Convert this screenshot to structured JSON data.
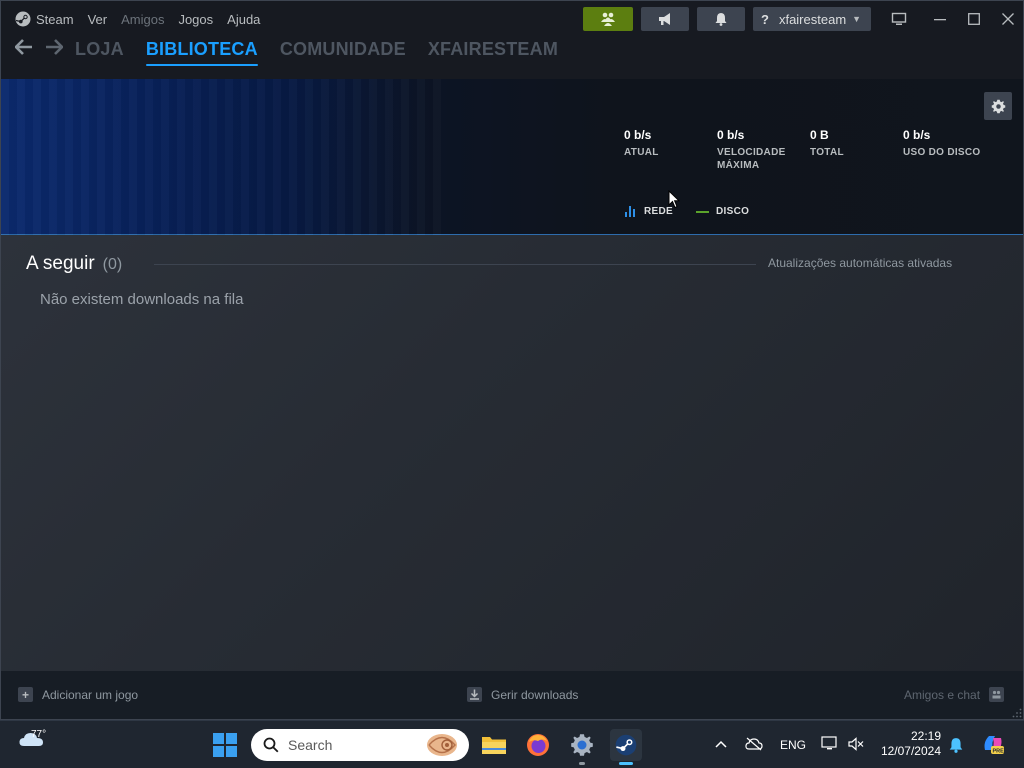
{
  "colors": {
    "accent": "#1a9fff",
    "friends_button": "#5c7e10",
    "rede_legend": "#2d8fe6",
    "disco_legend": "#5ba32b",
    "window_bg": "#171a21"
  },
  "menu": {
    "steam": "Steam",
    "ver": "Ver",
    "amigos": "Amigos",
    "jogos": "Jogos",
    "ajuda": "Ajuda"
  },
  "titlebar": {
    "account_help": "?",
    "account_name": "xfairesteam",
    "icons": [
      "friends-icon",
      "megaphone-icon",
      "bell-icon",
      "big-picture-icon",
      "minimize-icon",
      "maximize-icon",
      "close-icon"
    ]
  },
  "nav": {
    "tabs": [
      {
        "label": "LOJA",
        "active": false
      },
      {
        "label": "BIBLIOTECA",
        "active": true
      },
      {
        "label": "COMUNIDADE",
        "active": false
      },
      {
        "label": "XFAIRESTEAM",
        "active": false
      }
    ]
  },
  "stats": {
    "atual": {
      "value": "0 b/s",
      "label": "ATUAL"
    },
    "velocidade": {
      "value": "0 b/s",
      "label": "VELOCIDADE MÁXIMA"
    },
    "total": {
      "value": "0 B",
      "label": "TOTAL"
    },
    "disco": {
      "value": "0 b/s",
      "label": "USO DO DISCO"
    },
    "legend_rede": "REDE",
    "legend_disco": "DISCO"
  },
  "queue": {
    "title": "A seguir",
    "count": "(0)",
    "auto_updates": "Atualizações automáticas ativadas",
    "empty_message": "Não existem downloads na fila"
  },
  "footer": {
    "add_game": "Adicionar um jogo",
    "manage_downloads": "Gerir downloads",
    "friends_chat": "Amigos e chat"
  },
  "taskbar": {
    "weather_temp": "77°",
    "search_placeholder": "Search",
    "language": "ENG",
    "time": "22:19",
    "date": "12/07/2024",
    "apps": [
      "file-explorer-icon",
      "firefox-icon",
      "settings-icon",
      "steam-icon"
    ]
  }
}
